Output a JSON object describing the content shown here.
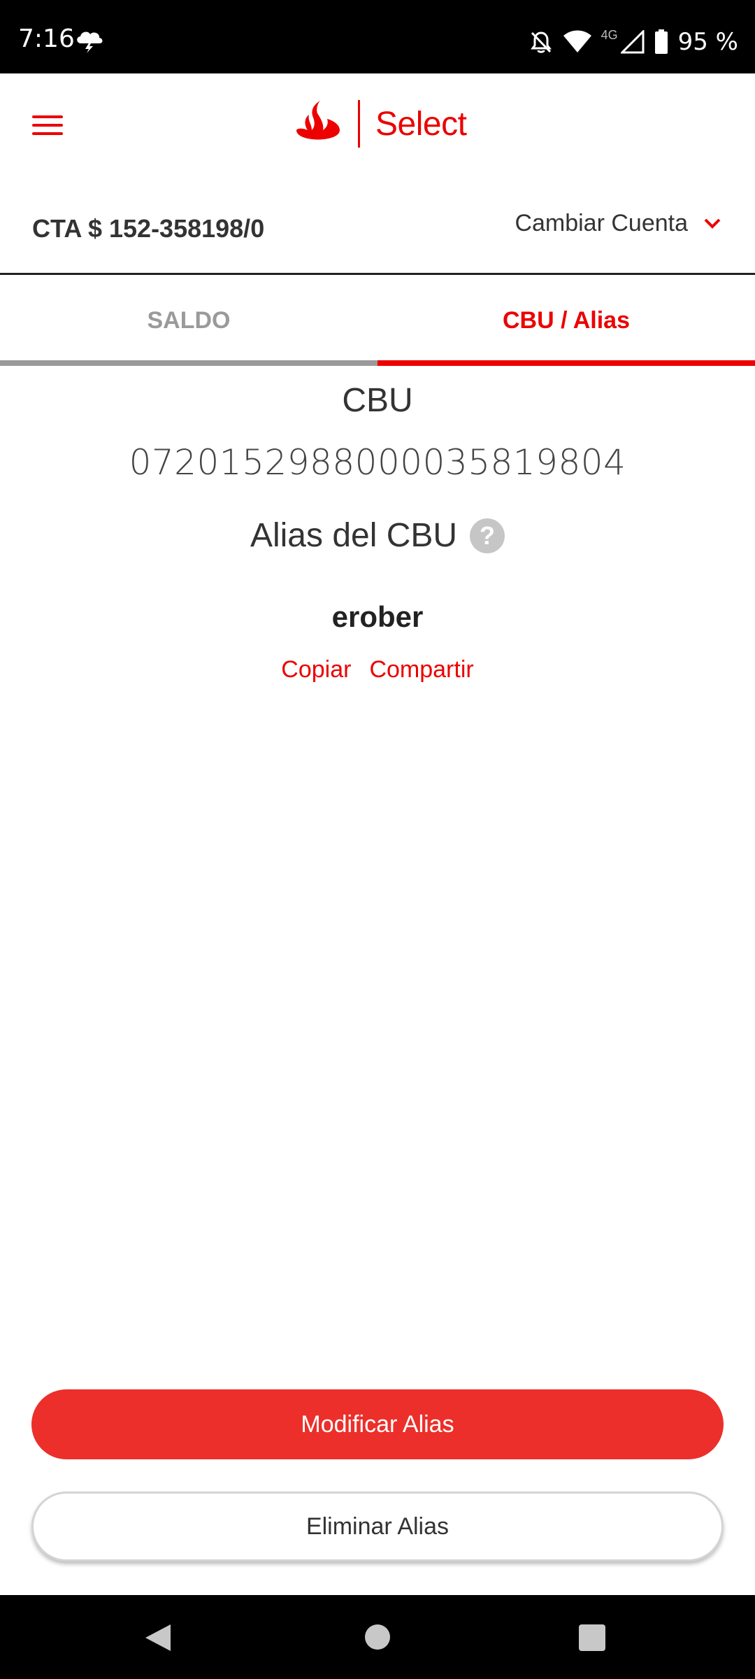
{
  "status_bar": {
    "time": "7:16",
    "network_type": "4G",
    "battery": "95 %"
  },
  "header": {
    "logo_text": "Select"
  },
  "account": {
    "number": "CTA $ 152-358198/0",
    "change_label": "Cambiar Cuenta"
  },
  "tabs": [
    {
      "label": "SALDO",
      "active": false
    },
    {
      "label": "CBU / Alias",
      "active": true
    }
  ],
  "cbu": {
    "title": "CBU",
    "value": "0720152988000035819804"
  },
  "alias": {
    "title": "Alias del CBU",
    "help_symbol": "?",
    "value": "erober",
    "copy_label": "Copiar",
    "share_label": "Compartir"
  },
  "actions": {
    "modify_label": "Modificar Alias",
    "delete_label": "Eliminar Alias"
  },
  "colors": {
    "brand_red": "#ec0000",
    "button_red": "#ec2f2a",
    "inactive_gray": "#9a9a9a"
  },
  "icons": {
    "status": [
      "cloud-lightning-icon",
      "bell-off-icon",
      "wifi-icon",
      "signal-icon",
      "battery-icon"
    ],
    "header": [
      "menu-icon",
      "santander-flame-icon"
    ],
    "nav": [
      "back-icon",
      "home-icon",
      "recents-icon"
    ]
  }
}
